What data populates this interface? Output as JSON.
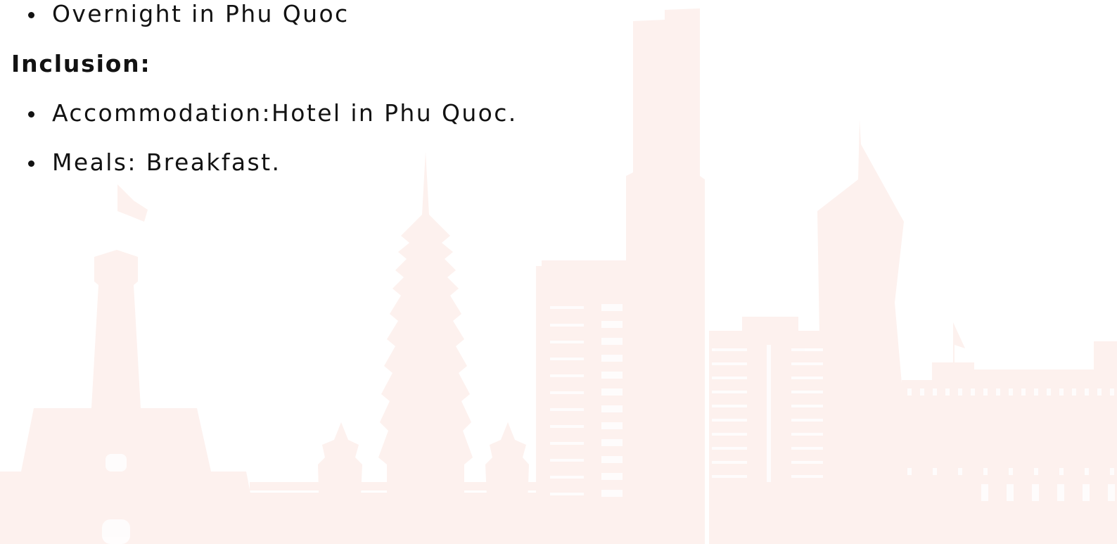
{
  "itinerary": {
    "overnight_items": [
      "Overnight in Phu Quoc"
    ],
    "inclusion_heading": "Inclusion:",
    "inclusion_items": [
      "Accommodation:Hotel in Phu Quoc.",
      "Meals: Breakfast."
    ]
  },
  "colors": {
    "text": "#121212",
    "skyline": "#fdf1ee",
    "background": "#ffffff"
  },
  "background_art": "vietnam-city-skyline-silhouette"
}
